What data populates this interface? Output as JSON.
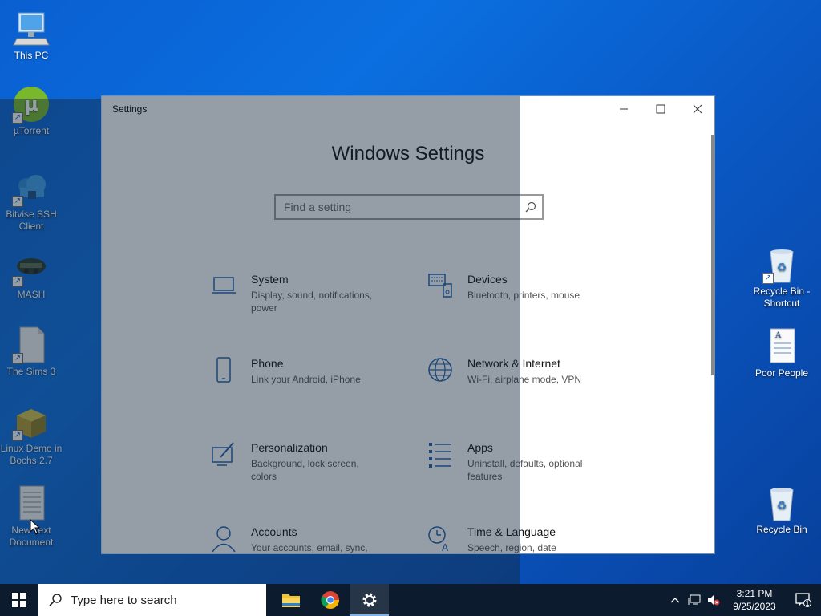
{
  "desktop": {
    "left_icons": [
      {
        "label": "This PC"
      },
      {
        "label": "µTorrent"
      },
      {
        "label": "Bitvise SSH Client"
      },
      {
        "label": "MASH"
      },
      {
        "label": "The Sims 3"
      },
      {
        "label": "Linux Demo in Bochs 2.7"
      },
      {
        "label": "New Text Document"
      }
    ],
    "right_icons": [
      {
        "label": "Recycle Bin - Shortcut"
      },
      {
        "label": "Poor People"
      },
      {
        "label": "Recycle Bin"
      }
    ]
  },
  "settings": {
    "window_title": "Settings",
    "heading": "Windows Settings",
    "search_placeholder": "Find a setting",
    "minimize": "—",
    "maximize": "☐",
    "close": "✕",
    "categories": [
      {
        "title": "System",
        "desc": "Display, sound, notifications, power",
        "icon": "laptop-icon"
      },
      {
        "title": "Devices",
        "desc": "Bluetooth, printers, mouse",
        "icon": "keyboard-icon"
      },
      {
        "title": "Phone",
        "desc": "Link your Android, iPhone",
        "icon": "phone-icon"
      },
      {
        "title": "Network & Internet",
        "desc": "Wi-Fi, airplane mode, VPN",
        "icon": "globe-icon"
      },
      {
        "title": "Personalization",
        "desc": "Background, lock screen, colors",
        "icon": "paintbrush-icon"
      },
      {
        "title": "Apps",
        "desc": "Uninstall, defaults, optional features",
        "icon": "apps-list-icon"
      },
      {
        "title": "Accounts",
        "desc": "Your accounts, email, sync,",
        "icon": "person-icon"
      },
      {
        "title": "Time & Language",
        "desc": "Speech, region, date",
        "icon": "time-language-icon"
      }
    ]
  },
  "taskbar": {
    "search_placeholder": "Type here to search",
    "time": "3:21 PM",
    "date": "9/25/2023",
    "notification_count": "1"
  },
  "colors": {
    "accent": "#1f5fa8",
    "taskbar": "#0c1b2e"
  }
}
